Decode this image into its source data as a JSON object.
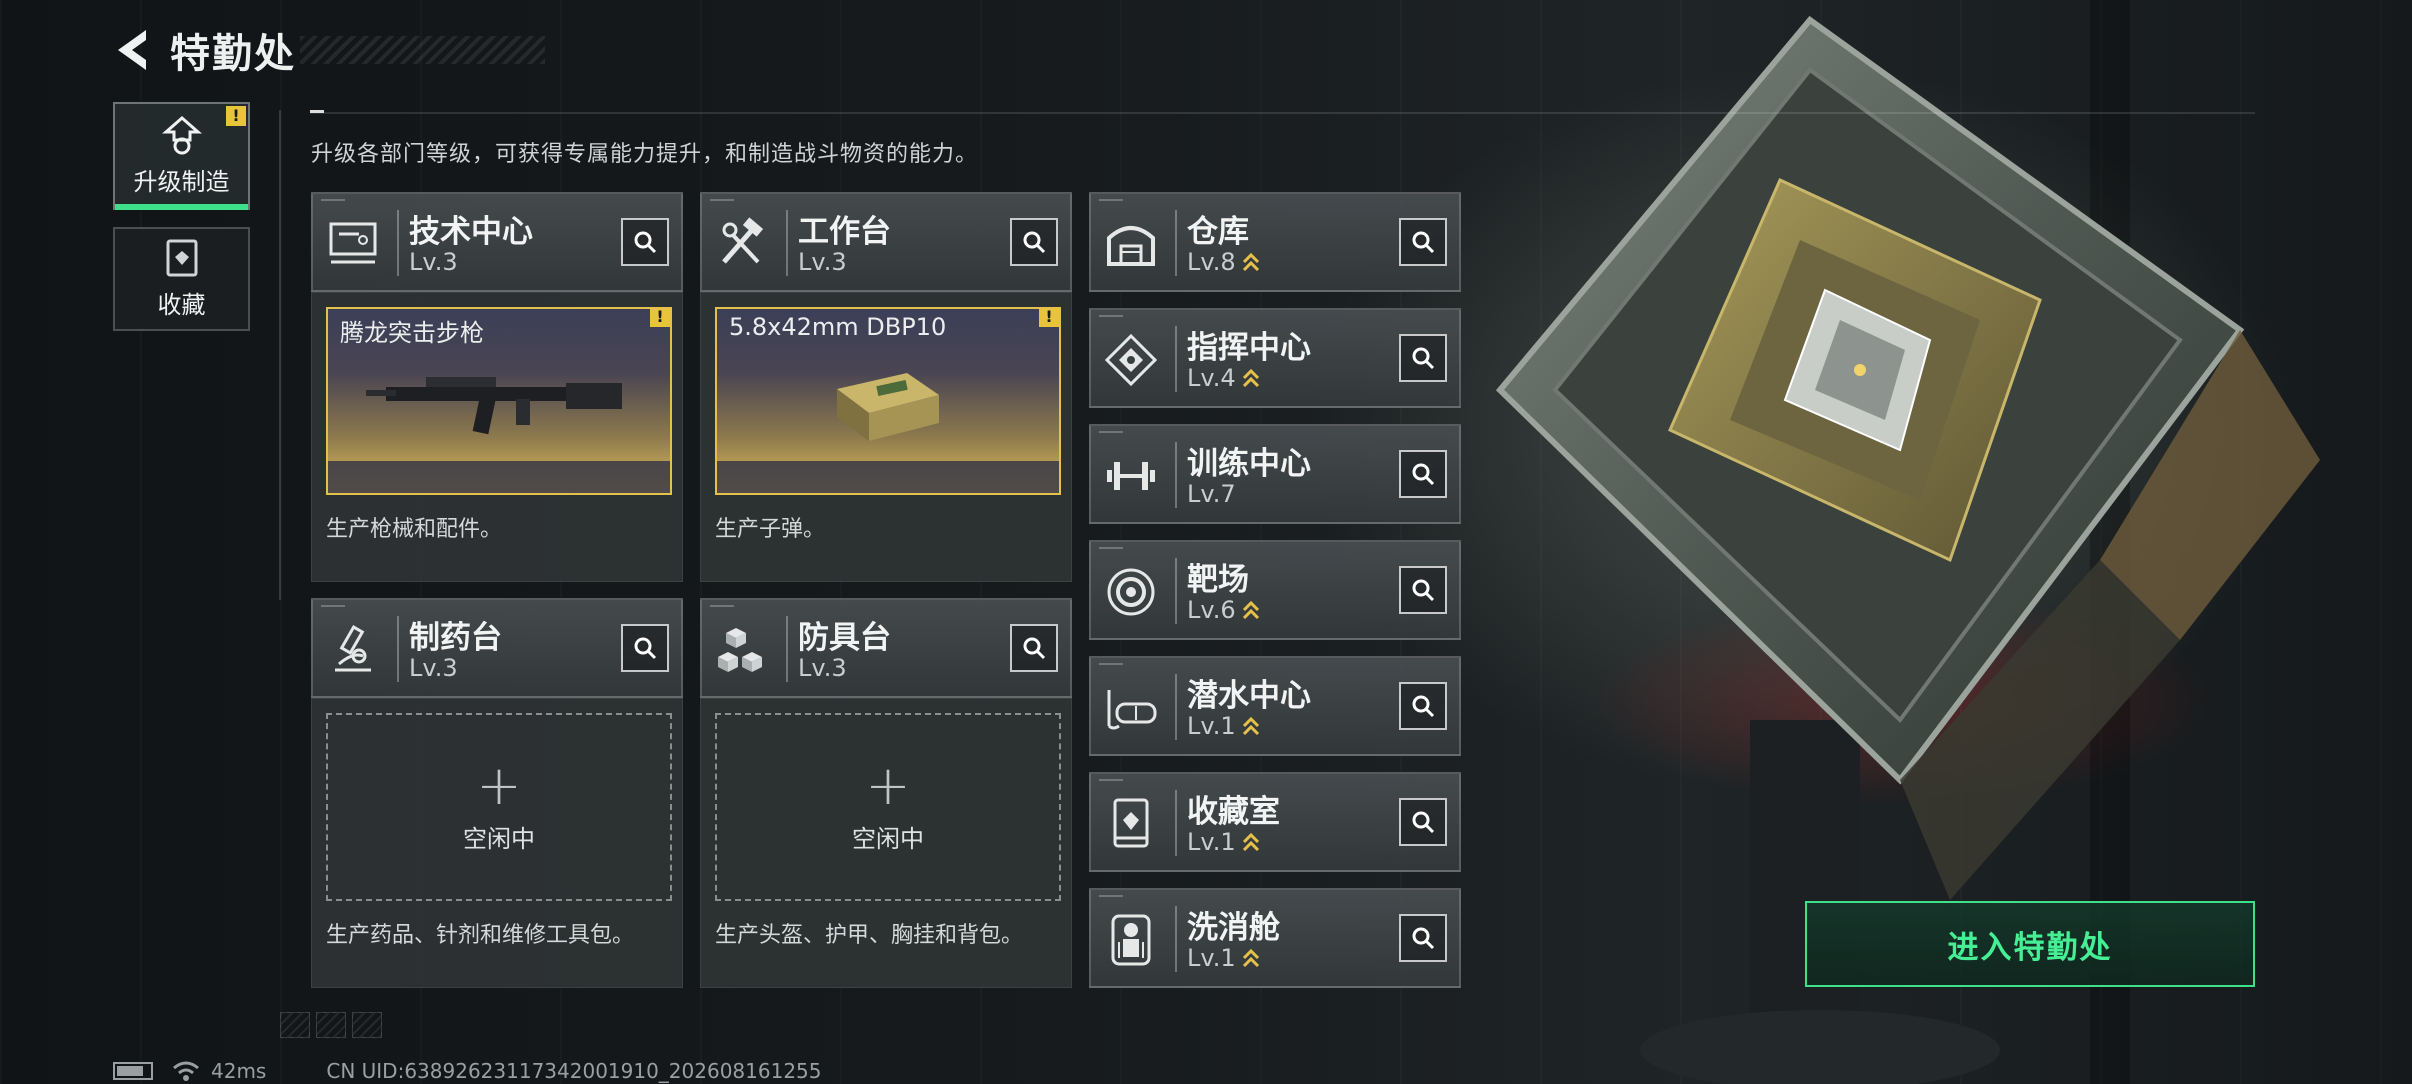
{
  "header": {
    "title": "特勤处"
  },
  "subtitle": "升级各部门等级，可获得专属能力提升，和制造战斗物资的能力。",
  "side_tabs": [
    {
      "label": "升级制造",
      "icon": "upgrade-icon",
      "active": true,
      "alert": "!"
    },
    {
      "label": "收藏",
      "icon": "collection-icon",
      "active": false
    }
  ],
  "production": [
    {
      "name": "技术中心",
      "level": "Lv.3",
      "icon": "monitor-icon",
      "slot_state": "active",
      "item": "腾龙突击步枪",
      "alert": "!",
      "desc": "生产枪械和配件。"
    },
    {
      "name": "工作台",
      "level": "Lv.3",
      "icon": "tools-icon",
      "slot_state": "active",
      "item": "5.8x42mm DBP10",
      "alert": "!",
      "desc": "生产子弹。"
    },
    {
      "name": "制药台",
      "level": "Lv.3",
      "icon": "microscope-icon",
      "slot_state": "idle",
      "idle_label": "空闲中",
      "plus": "+",
      "desc": "生产药品、针剂和维修工具包。"
    },
    {
      "name": "防具台",
      "level": "Lv.3",
      "icon": "armor-blocks-icon",
      "slot_state": "idle",
      "idle_label": "空闲中",
      "plus": "+",
      "desc": "生产头盔、护甲、胸挂和背包。"
    }
  ],
  "facilities": [
    {
      "name": "仓库",
      "level": "Lv.8",
      "icon": "warehouse-icon",
      "upgradable": true
    },
    {
      "name": "指挥中心",
      "level": "Lv.4",
      "icon": "command-chip-icon",
      "upgradable": true
    },
    {
      "name": "训练中心",
      "level": "Lv.7",
      "icon": "dumbbell-icon",
      "upgradable": false
    },
    {
      "name": "靶场",
      "level": "Lv.6",
      "icon": "target-icon",
      "upgradable": true
    },
    {
      "name": "潜水中心",
      "level": "Lv.1",
      "icon": "diving-mask-icon",
      "upgradable": true
    },
    {
      "name": "收藏室",
      "level": "Lv.1",
      "icon": "display-case-icon",
      "upgradable": true
    },
    {
      "name": "洗消舱",
      "level": "Lv.1",
      "icon": "decon-suit-icon",
      "upgradable": true
    }
  ],
  "enter_button": "进入特勤处",
  "status": {
    "ping": "42ms",
    "uid": "CN UID:6389262311734200191​0_202608161255"
  },
  "colors": {
    "accent_green": "#3ee08a",
    "alert_yellow": "#e8c43a",
    "upgrade_gold": "#e5c04a"
  }
}
